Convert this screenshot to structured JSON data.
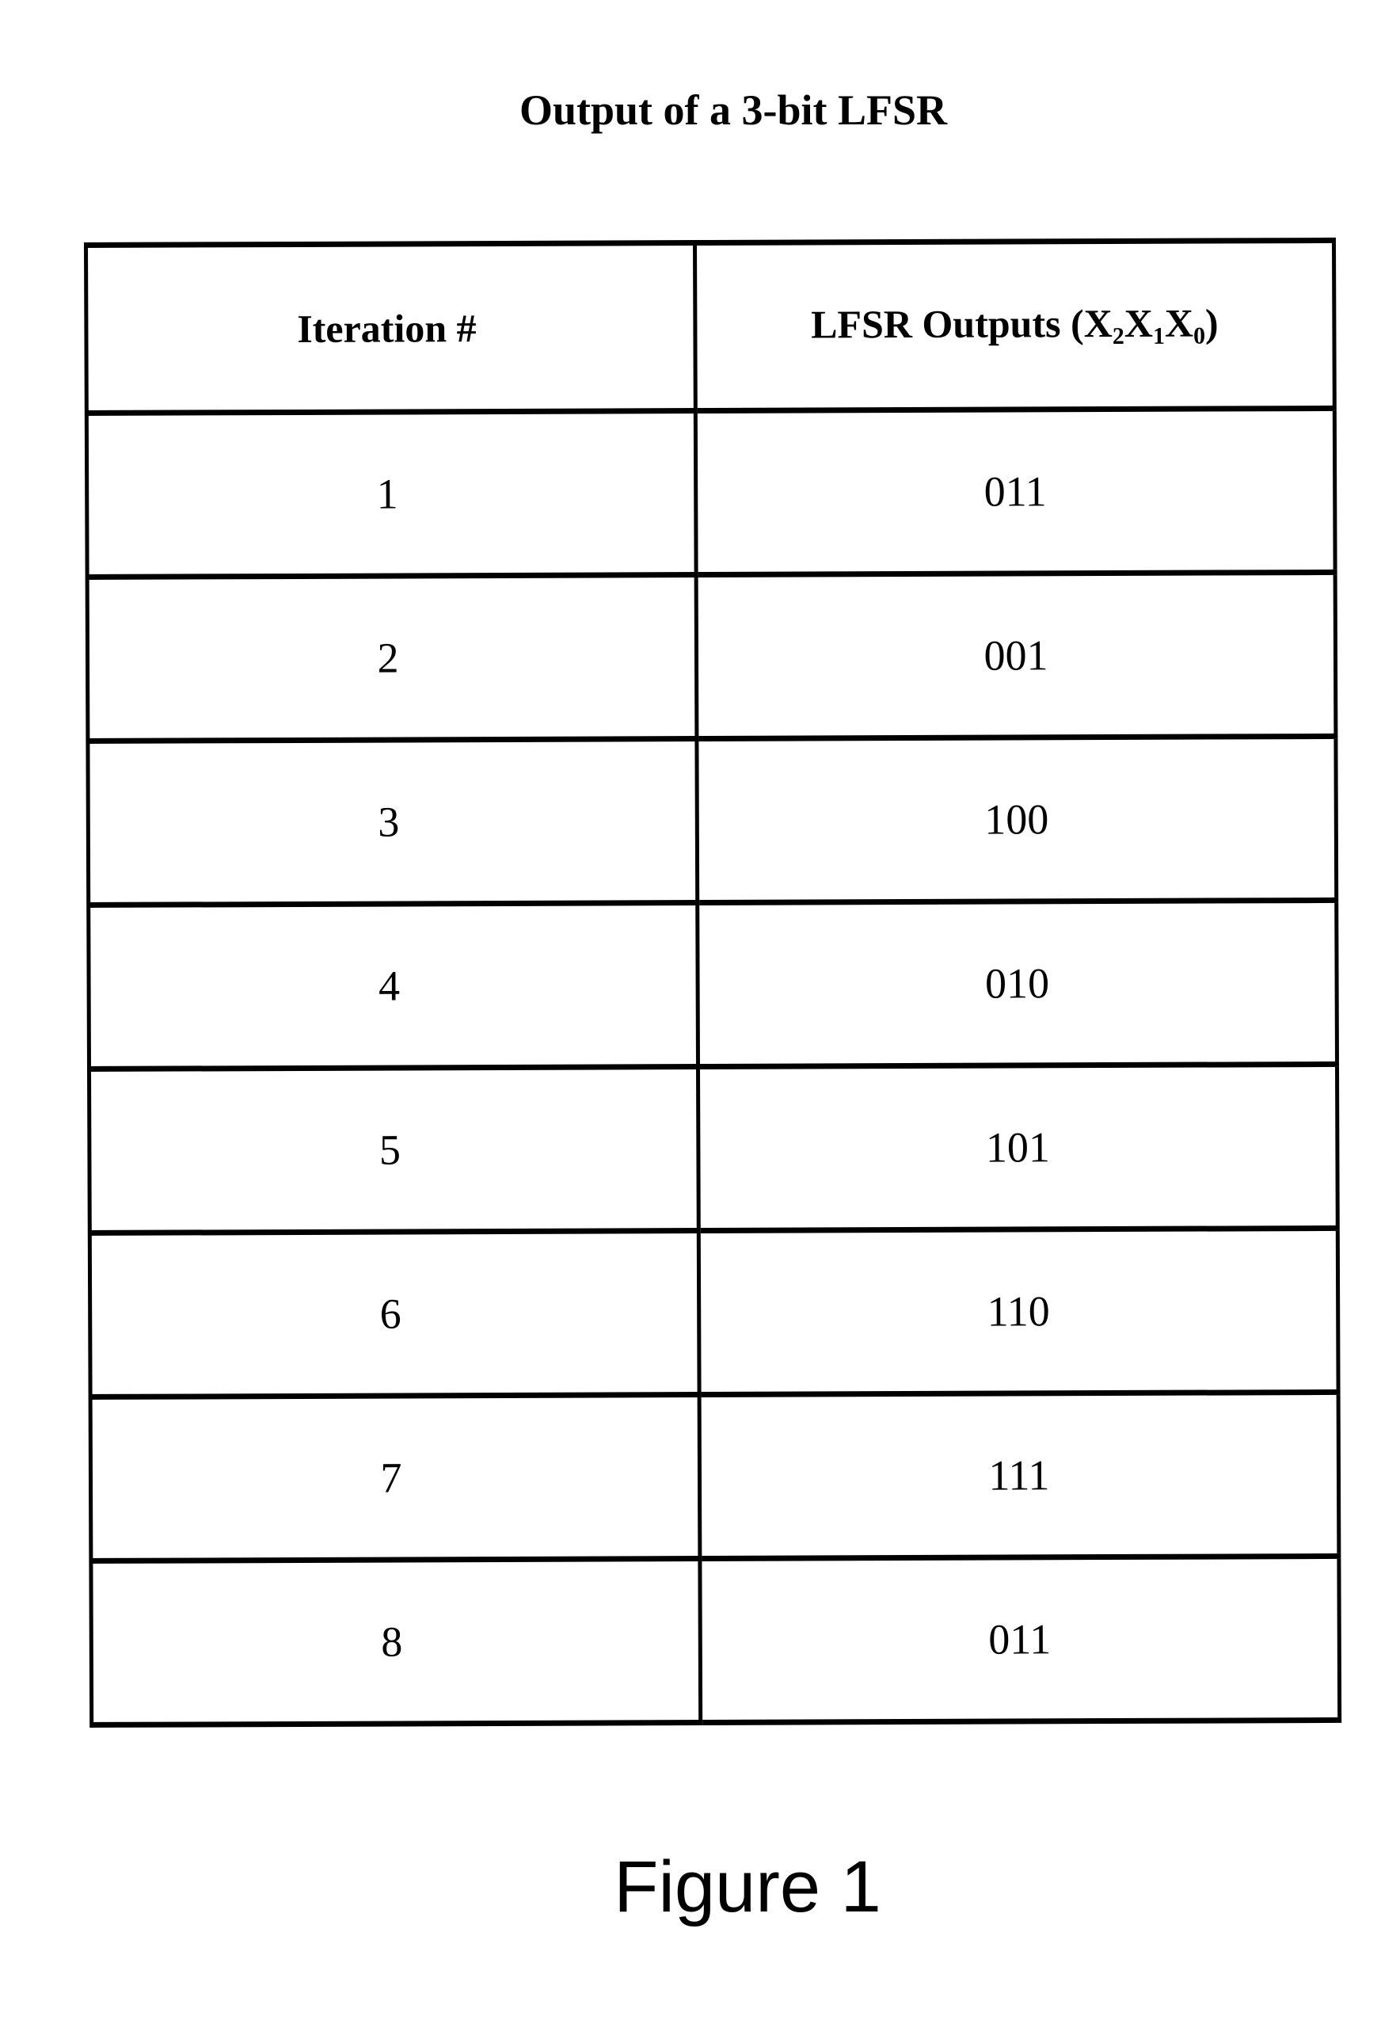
{
  "title": "Output of a 3-bit LFSR",
  "table": {
    "headers": {
      "iteration": "Iteration #",
      "outputs_prefix": "LFSR Outputs (",
      "outputs_vars": [
        {
          "base": "X",
          "sub": "2"
        },
        {
          "base": "X",
          "sub": "1"
        },
        {
          "base": "X",
          "sub": "0"
        }
      ],
      "outputs_suffix": ")"
    },
    "rows": [
      {
        "iteration": "1",
        "output": "011"
      },
      {
        "iteration": "2",
        "output": "001"
      },
      {
        "iteration": "3",
        "output": "100"
      },
      {
        "iteration": "4",
        "output": "010"
      },
      {
        "iteration": "5",
        "output": "101"
      },
      {
        "iteration": "6",
        "output": "110"
      },
      {
        "iteration": "7",
        "output": "111"
      },
      {
        "iteration": "8",
        "output": "011"
      }
    ]
  },
  "caption": "Figure 1"
}
